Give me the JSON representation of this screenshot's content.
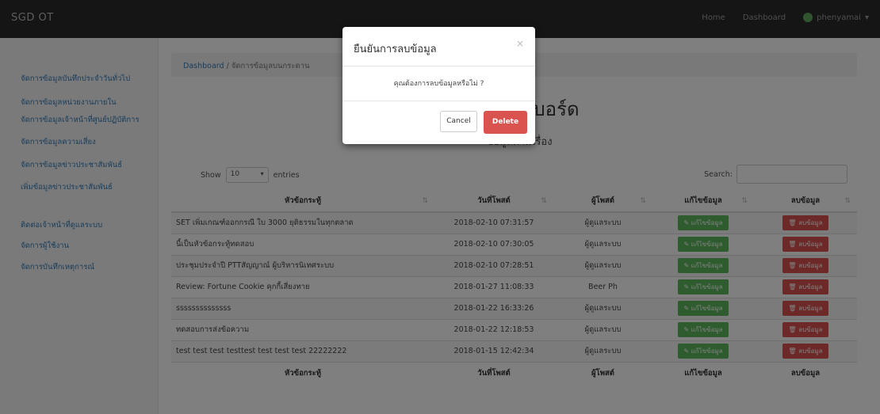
{
  "navbar": {
    "brand": "SGD OT",
    "links": [
      "Home",
      "Dashboard"
    ],
    "user": "phenyamai"
  },
  "sidebar": {
    "items": [
      "จัดการข้อมูลบันทึกประจำวันทั่วไป",
      "จัดการข้อมูลหน่วยงานภายใน",
      "จัดการข้อมูลเจ้าหน้าที่ศูนย์ปฏิบัติการ",
      "จัดการข้อมูลความเสี่ยง",
      "จัดการข้อมูลข่าวประชาสัมพันธ์",
      "เพิ่มข้อมูลข่าวประชาสัมพันธ์",
      "ติดต่อเจ้าหน้าที่ดูแลระบบ",
      "จัดการผู้ใช้งาน",
      "จัดการบันทึกเหตุการณ์"
    ]
  },
  "breadcrumb": {
    "home": "Dashboard",
    "separator": "/",
    "current": "จัดการข้อมูลบนกระดาน"
  },
  "page": {
    "title": "ข้อมูลบนบอร์ด",
    "subtitle": "ข้อมูลตามเรื่อง"
  },
  "controls": {
    "show_label": "Show",
    "show_value": "10",
    "entries_label": "entries",
    "search_label": "Search:"
  },
  "table": {
    "headers": [
      "หัวข้อกระทู้",
      "วันที่โพสต์",
      "ผู้โพสต์",
      "แก้ไขข้อมูล",
      "ลบข้อมูล"
    ],
    "rows": [
      [
        "SET เพิ่มเกณฑ์ออกกรณี ใบ 3000 ยุติธรรมในทุกตลาด",
        "2018-02-10 07:31:57",
        "ผู้ดูแลระบบ"
      ],
      [
        "นี้เป็นหัวข้อกระทู้ทดสอบ",
        "2018-02-10 07:30:05",
        "ผู้ดูแลระบบ"
      ],
      [
        "ประชุมประจำปี PTTสัญญาณ์ ผู้บริหารนิเทศระบบ",
        "2018-02-10 07:28:51",
        "ผู้ดูแลระบบ"
      ],
      [
        "Review: Fortune Cookie คุกกี้เสี่ยงทาย",
        "2018-01-27 11:08:33",
        "Beer Ph"
      ],
      [
        "ssssssssssssss",
        "2018-01-22 16:33:26",
        "ผู้ดูแลระบบ"
      ],
      [
        "ทดสอบการส่งข้อความ",
        "2018-01-22 12:18:53",
        "ผู้ดูแลระบบ"
      ],
      [
        "test test test testtest test test test 22222222",
        "2018-01-15 12:42:34",
        "ผู้ดูแลระบบ"
      ]
    ],
    "edit_label": "แก้ไขข้อมูล",
    "delete_label": "ลบข้อมูล",
    "sort_icon": "sort-icon"
  },
  "modal": {
    "title": "ยืนยันการลบข้อมูล",
    "close": "×",
    "message": "คุณต้องการลบข้อมูลหรือไม่ ?",
    "cancel_label": "Cancel",
    "delete_label": "Delete"
  },
  "colors": {
    "navbar": "#2b2b2b",
    "edit": "#5cb85c",
    "delete": "#d9534f",
    "link": "#337ab7"
  }
}
